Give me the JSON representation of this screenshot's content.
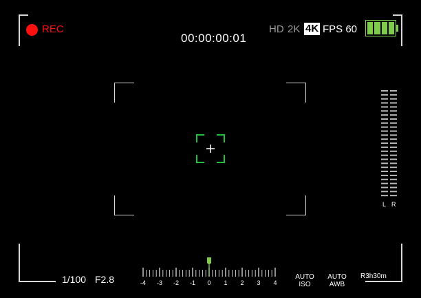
{
  "recording": {
    "label": "REC",
    "dot_color": "#ff1010"
  },
  "timecode": "00:00:00:01",
  "format": {
    "hd": "HD",
    "res": "2K",
    "badge": "4K",
    "fps": "FPS 60",
    "dim_color": "#9a9a9a"
  },
  "battery": {
    "segments": 4,
    "level": 1.0,
    "color": "#7fcc4d"
  },
  "audio_meter": {
    "left_label": "L",
    "right_label": "R",
    "bars": 27
  },
  "exposure": {
    "shutter": "1/100",
    "aperture": "F2.8"
  },
  "ev_scale": {
    "ticks": [
      "-4",
      "-3",
      "-2",
      "-1",
      "0",
      "1",
      "2",
      "3",
      "4"
    ],
    "value": 0,
    "indicator_color": "#7fcc4d"
  },
  "iso": {
    "line1": "AUTO",
    "line2": "ISO"
  },
  "awb": {
    "line1": "AUTO",
    "line2": "AWB"
  },
  "remaining": "R3h30m"
}
